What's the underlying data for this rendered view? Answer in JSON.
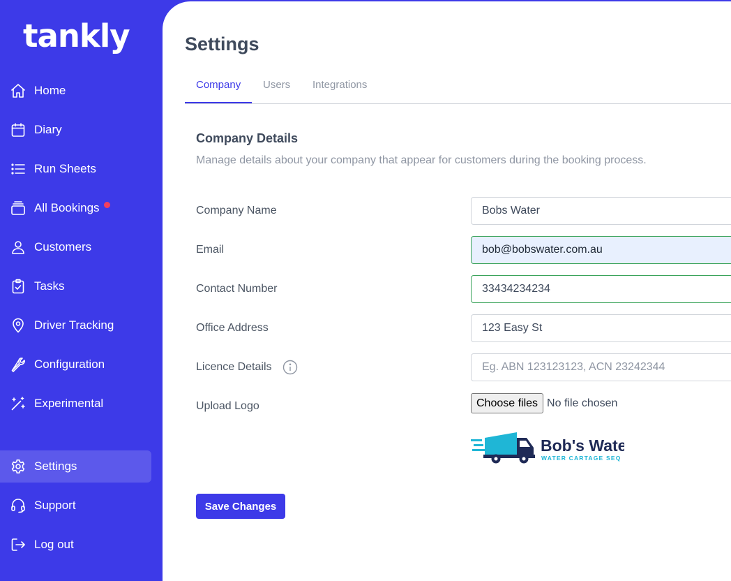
{
  "brand": {
    "name": "tankly",
    "accent": "#3d3ae8"
  },
  "sidebar": {
    "items": [
      {
        "label": "Home",
        "icon": "home-icon"
      },
      {
        "label": "Diary",
        "icon": "calendar-icon"
      },
      {
        "label": "Run Sheets",
        "icon": "list-icon"
      },
      {
        "label": "All Bookings",
        "icon": "stack-icon",
        "badge": "red-dot"
      },
      {
        "label": "Customers",
        "icon": "user-icon"
      },
      {
        "label": "Tasks",
        "icon": "clipboard-check-icon"
      },
      {
        "label": "Driver Tracking",
        "icon": "map-pin-icon"
      },
      {
        "label": "Configuration",
        "icon": "wrench-icon"
      },
      {
        "label": "Experimental",
        "icon": "magic-wand-icon"
      },
      {
        "label": "Settings",
        "icon": "gear-icon",
        "active": true
      },
      {
        "label": "Support",
        "icon": "headset-icon"
      },
      {
        "label": "Log out",
        "icon": "logout-icon"
      }
    ]
  },
  "page": {
    "title": "Settings",
    "tabs": [
      {
        "label": "Company",
        "active": true
      },
      {
        "label": "Users"
      },
      {
        "label": "Integrations"
      }
    ]
  },
  "company_details": {
    "title": "Company Details",
    "description": "Manage details about your company that appear for customers during the booking process.",
    "fields": {
      "company_name": {
        "label": "Company Name",
        "value": "Bobs Water"
      },
      "email": {
        "label": "Email",
        "value": "bob@bobswater.com.au"
      },
      "contact_number": {
        "label": "Contact Number",
        "value": "33434234234"
      },
      "office_address": {
        "label": "Office Address",
        "value": "123 Easy St"
      },
      "licence_details": {
        "label": "Licence Details",
        "value": "",
        "placeholder": "Eg. ABN 123123123, ACN 23242344"
      }
    },
    "upload_logo": {
      "label": "Upload Logo",
      "button": "Choose files",
      "status": "No file chosen",
      "logo_name": "Bob's Water",
      "logo_tagline": "WATER CARTAGE SEQ"
    },
    "save_label": "Save Changes"
  }
}
